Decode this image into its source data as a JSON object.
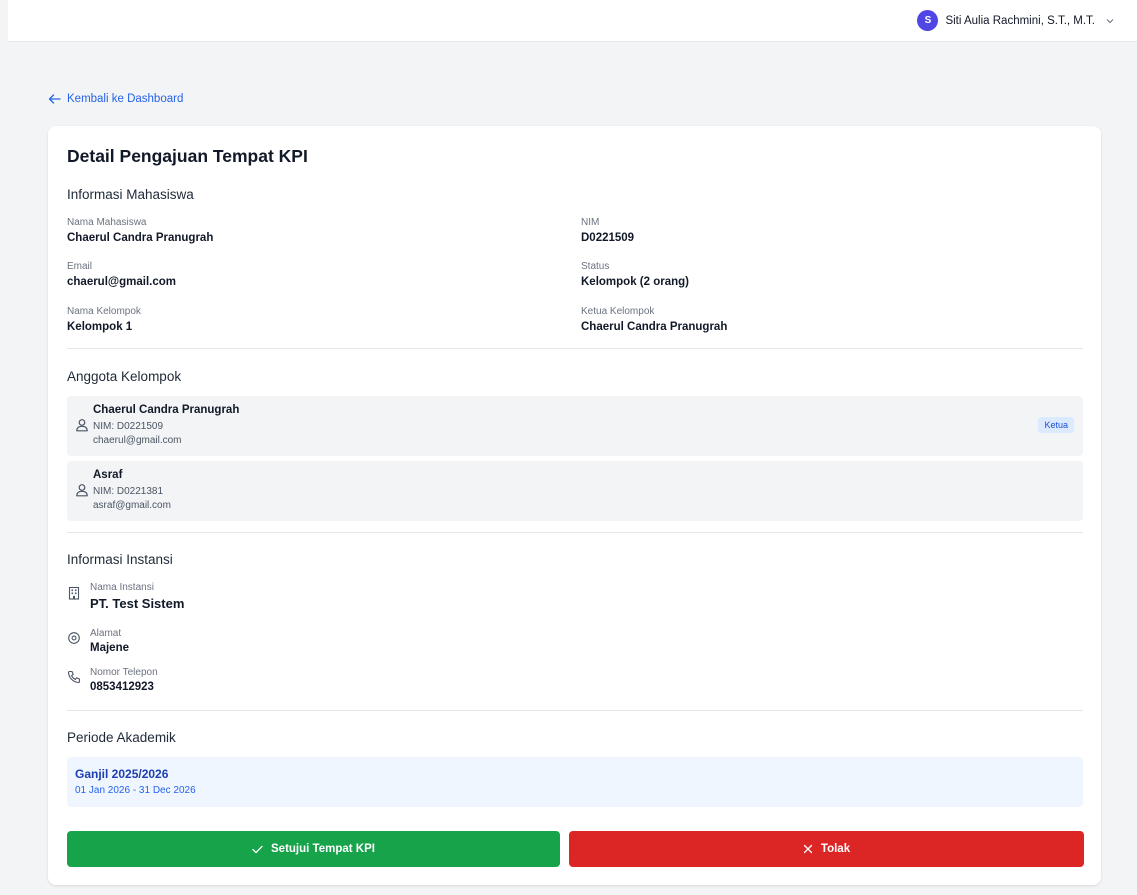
{
  "header": {
    "avatar_initial": "S",
    "user_name": "Siti Aulia Rachmini, S.T., M.T."
  },
  "back_link": "Kembali ke Dashboard",
  "title": "Detail Pengajuan Tempat KPI",
  "mahasiswa": {
    "heading": "Informasi Mahasiswa",
    "nama_label": "Nama Mahasiswa",
    "nama": "Chaerul Candra Pranugrah",
    "nim_label": "NIM",
    "nim": "D0221509",
    "email_label": "Email",
    "email": "chaerul@gmail.com",
    "status_label": "Status",
    "status": "Kelompok (2 orang)",
    "kelompok_label": "Nama Kelompok",
    "kelompok": "Kelompok 1",
    "ketua_label": "Ketua Kelompok",
    "ketua": "Chaerul Candra Pranugrah"
  },
  "anggota": {
    "heading": "Anggota Kelompok",
    "members": [
      {
        "name": "Chaerul Candra Pranugrah",
        "nim": "NIM: D0221509",
        "email": "chaerul@gmail.com",
        "badge": "Ketua"
      },
      {
        "name": "Asraf",
        "nim": "NIM: D0221381",
        "email": "asraf@gmail.com"
      }
    ]
  },
  "instansi": {
    "heading": "Informasi Instansi",
    "nama_label": "Nama Instansi",
    "nama": "PT. Test Sistem",
    "alamat_label": "Alamat",
    "alamat": "Majene",
    "telepon_label": "Nomor Telepon",
    "telepon": "0853412923"
  },
  "periode": {
    "heading": "Periode Akademik",
    "name": "Ganjil 2025/2026",
    "dates": "01 Jan 2026 - 31 Dec 2026"
  },
  "actions": {
    "approve": "Setujui Tempat KPI",
    "reject": "Tolak"
  },
  "colors": {
    "primary": "#4f46e5",
    "link": "#2563eb",
    "approve": "#16a34a",
    "reject": "#dc2626"
  }
}
